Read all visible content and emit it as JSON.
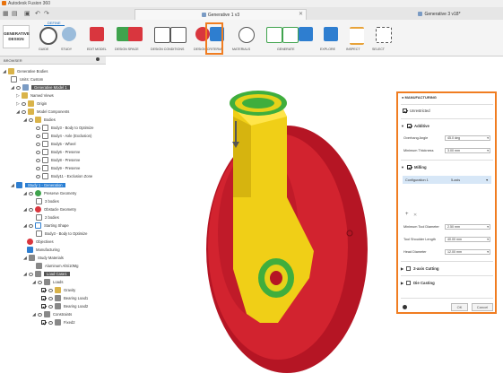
{
  "app": {
    "title": "Autodesk Fusion 360"
  },
  "tabs": [
    {
      "label": "Generative 1 v3"
    },
    {
      "label": "Generative 3 v18*"
    }
  ],
  "ribbon": {
    "workspace_label": "GENERATIVE DESIGN",
    "active_tab": "DEFINE",
    "tools": [
      {
        "label": "GUIDE"
      },
      {
        "label": "STUDY"
      },
      {
        "label": "EDIT MODEL"
      },
      {
        "label": "DESIGN SPACE"
      },
      {
        "label": "DESIGN CONDITIONS"
      },
      {
        "label": "DESIGN CRITERIA"
      },
      {
        "label": "MATERIALS"
      },
      {
        "label": "GENERATE"
      },
      {
        "label": "EXPLORE"
      },
      {
        "label": "INSPECT"
      },
      {
        "label": "SELECT"
      }
    ]
  },
  "browser": {
    "header": "BROWSER",
    "items": [
      {
        "label": "Generative Bodies"
      },
      {
        "label": "Units: Custom"
      },
      {
        "label": "Generative Model 1"
      },
      {
        "label": "Named Views"
      },
      {
        "label": "Origin"
      },
      {
        "label": "Model Components"
      },
      {
        "label": "Bodies"
      },
      {
        "label": "Body3 - Body to Optimize"
      },
      {
        "label": "Body4 - Axle (Exclusion)"
      },
      {
        "label": "Body5 - Wheel"
      },
      {
        "label": "Body6 - Preserve"
      },
      {
        "label": "Body8 - Preserve"
      },
      {
        "label": "Body9 - Preserve"
      },
      {
        "label": "Body11 - Exclusion Zone"
      },
      {
        "label": "Study 1 - Generation"
      },
      {
        "label": "Preserve Geometry"
      },
      {
        "label": "3 bodies"
      },
      {
        "label": "Obstacle Geometry"
      },
      {
        "label": "2 bodies"
      },
      {
        "label": "Starting Shape"
      },
      {
        "label": "Body3 - Body to Optimize"
      },
      {
        "label": "Objectives"
      },
      {
        "label": "Manufacturing"
      },
      {
        "label": "Study Materials"
      },
      {
        "label": "Aluminum AlSi10Mg"
      },
      {
        "label": "Load Case1"
      },
      {
        "label": "Loads"
      },
      {
        "label": "Gravity"
      },
      {
        "label": "Bearing Load1"
      },
      {
        "label": "Bearing Load2"
      },
      {
        "label": "Constraints"
      },
      {
        "label": "Fixed2"
      }
    ]
  },
  "panel": {
    "title": "MANUFACTURING",
    "unrestricted": "Unrestricted",
    "additive": "Additive",
    "overhang_label": "Overhang Angle",
    "overhang_value": "45.0 deg",
    "min_thickness_label": "Minimum Thickness",
    "min_thickness_value": "3.00 mm",
    "milling": "Milling",
    "configuration_label": "Configuration 1",
    "configuration_value": "5-axis",
    "min_tool_label": "Minimum Tool Diameter",
    "min_tool_value": "2.50 mm",
    "tool_shoulder_label": "Tool Shoulder Length",
    "tool_shoulder_value": "40.00 mm",
    "head_diameter_label": "Head Diameter",
    "head_diameter_value": "12.00 mm",
    "axis2_cutting": "2-axis Cutting",
    "die_casting": "Die Casting",
    "ok": "OK",
    "cancel": "Cancel"
  },
  "colors": {
    "accent": "#f07d21",
    "selection": "#2a7fd4",
    "wheel_red": "#c8192a",
    "body_yellow": "#f2d31a",
    "pattern_green": "#3fae3d"
  }
}
